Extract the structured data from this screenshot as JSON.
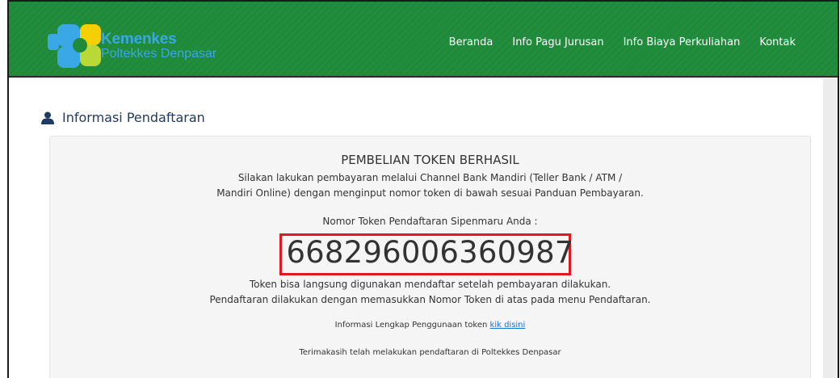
{
  "brand": {
    "title": "Kemenkes",
    "subtitle": "Poltekkes Denpasar"
  },
  "nav": {
    "items": [
      "Beranda",
      "Info Pagu Jurusan",
      "Info Biaya Perkuliahan",
      "Kontak"
    ]
  },
  "section": {
    "title": "Informasi Pendaftaran",
    "icon": "user-icon"
  },
  "panel": {
    "heading": "PEMBELIAN TOKEN BERHASIL",
    "desc_line1": "Silakan lakukan pembayaran melalui Channel Bank Mandiri (Teller Bank / ATM /",
    "desc_line2": "Mandiri Online) dengan menginput nomor token di bawah sesuai Panduan Pembayaran.",
    "token_label": "Nomor Token Pendaftaran Sipenmaru Anda :",
    "token_value": "668296006360987",
    "after_line1": "Token bisa langsung digunakan mendaftar setelah pembayaran dilakukan.",
    "after_line2": "Pendaftaran dilakukan dengan memasukkan Nomor Token di atas pada menu Pendaftaran.",
    "info_text": "Informasi Lengkap Penggunaan token ",
    "info_link": "kik disini",
    "thanks": "Terimakasih telah melakukan pendaftaran di Poltekkes Denpasar"
  },
  "colors": {
    "navbar": "#1e8a3a",
    "brand_text": "#3aa7e6",
    "highlight_border": "#e0191f",
    "section_title": "#1f3b63",
    "link": "#1a6fd0"
  }
}
